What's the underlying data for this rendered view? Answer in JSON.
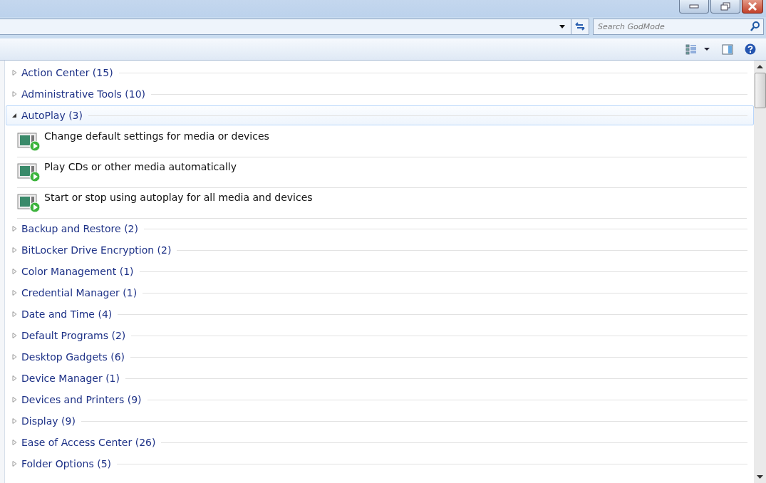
{
  "search": {
    "placeholder": "Search GodMode"
  },
  "groups": [
    {
      "label": "Action Center (15)",
      "expanded": false
    },
    {
      "label": "Administrative Tools (10)",
      "expanded": false
    },
    {
      "label": "AutoPlay (3)",
      "expanded": true,
      "children": [
        {
          "label": "Change default settings for media or devices"
        },
        {
          "label": "Play CDs or other media automatically"
        },
        {
          "label": "Start or stop using autoplay for all media and devices"
        }
      ]
    },
    {
      "label": "Backup and Restore (2)",
      "expanded": false
    },
    {
      "label": "BitLocker Drive Encryption (2)",
      "expanded": false
    },
    {
      "label": "Color Management (1)",
      "expanded": false
    },
    {
      "label": "Credential Manager (1)",
      "expanded": false
    },
    {
      "label": "Date and Time (4)",
      "expanded": false
    },
    {
      "label": "Default Programs (2)",
      "expanded": false
    },
    {
      "label": "Desktop Gadgets (6)",
      "expanded": false
    },
    {
      "label": "Device Manager (1)",
      "expanded": false
    },
    {
      "label": "Devices and Printers (9)",
      "expanded": false
    },
    {
      "label": "Display (9)",
      "expanded": false
    },
    {
      "label": "Ease of Access Center (26)",
      "expanded": false
    },
    {
      "label": "Folder Options (5)",
      "expanded": false
    }
  ]
}
